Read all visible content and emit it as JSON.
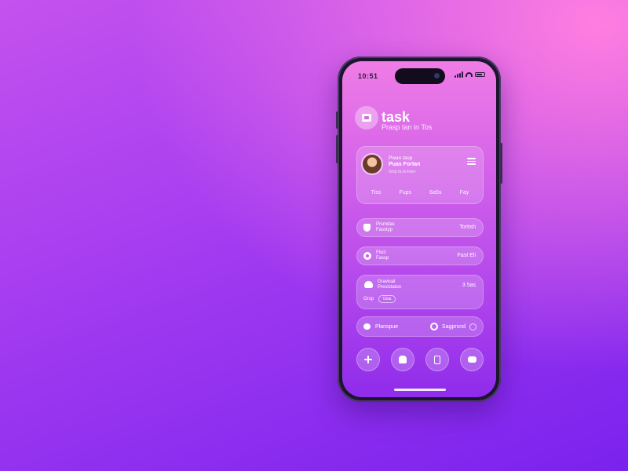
{
  "status_bar": {
    "time": "10:51"
  },
  "app": {
    "title": "task",
    "subtitle": "Prasp tan in Tos"
  },
  "profile": {
    "name": "Pwan tasp",
    "role": "Puas Fortan",
    "extra": "Grsp ta ta Fasn",
    "stats": [
      "Tiss",
      "Fups",
      "6a5s",
      "Fay"
    ]
  },
  "rows": [
    {
      "label_line1": "Prsmdas",
      "label_line2": "Fasstyp",
      "right": "Tortish"
    },
    {
      "label_line1": "Flsct",
      "label_line2": "Fassp",
      "right": "Fast Eli"
    }
  ],
  "tall_card": {
    "label_line1": "Graviual",
    "label_line2": "Presistatun",
    "right": "3 5as",
    "foot_label": "Grsp",
    "foot_pill": "Gisa"
  },
  "toggle_card": {
    "left_label": "Planspue",
    "right_label": "Sagprsnd"
  },
  "actions": [
    {
      "name": "add",
      "icon": "plus-icon"
    },
    {
      "name": "plant",
      "icon": "plant-icon"
    },
    {
      "name": "device",
      "icon": "device-icon"
    },
    {
      "name": "chat",
      "icon": "chat-icon"
    }
  ]
}
